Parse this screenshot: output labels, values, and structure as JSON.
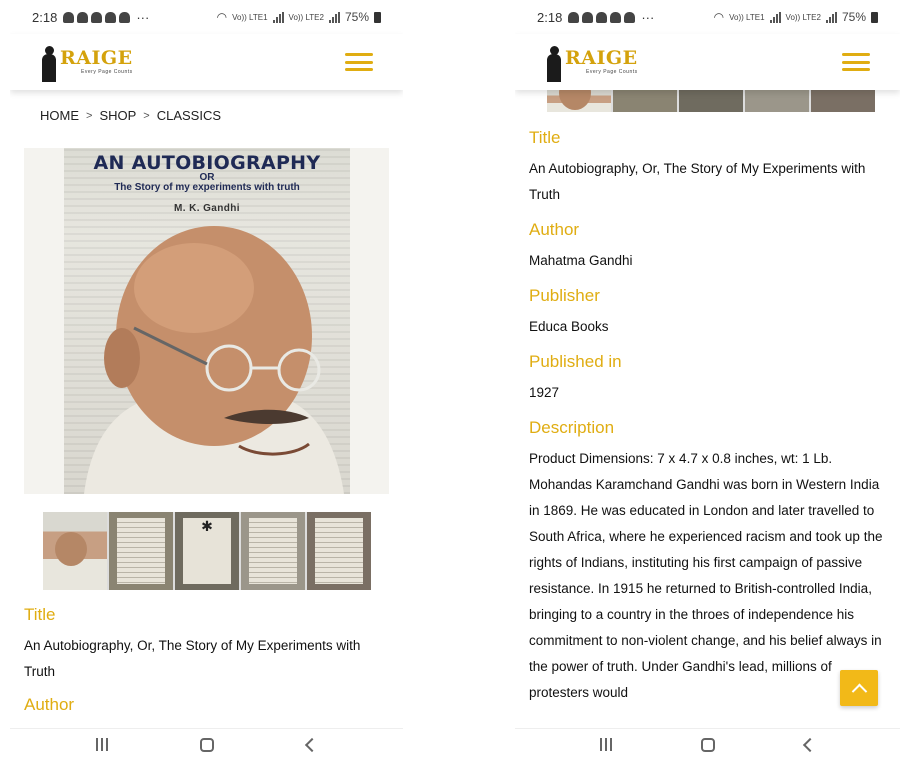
{
  "status_bar": {
    "time": "2:18",
    "more": "···",
    "network": "Vo)) LTE1",
    "network2": "Vo)) LTE2",
    "battery": "75%"
  },
  "brand": {
    "logo_text": "RAIGE",
    "tagline": "Every Page Counts"
  },
  "breadcrumb": {
    "home": "HOME",
    "shop": "SHOP",
    "category": "CLASSICS",
    "separator": ">"
  },
  "cover": {
    "title": "AN AUTOBIOGRAPHY",
    "or": "OR",
    "subtitle": "The Story of my experiments with truth",
    "author": "M. K. Gandhi"
  },
  "details": {
    "title_label": "Title",
    "title_value": "An Autobiography, Or, The Story of My Experiments with Truth",
    "author_label": "Author",
    "author_value": "Mahatma Gandhi",
    "publisher_label": "Publisher",
    "publisher_value": "Educa Books",
    "published_label": "Published in",
    "published_value": "1927",
    "description_label": "Description",
    "description_value": "Product Dimensions: 7 x 4.7 x 0.8 inches, wt: 1 Lb. Mohandas Karamchand Gandhi was born in Western India in 1869. He was educated in London and later travelled to South Africa, where he experienced racism and took up the rights of Indians, instituting his first campaign of passive resistance. In 1915 he returned to British-controlled India, bringing to a country in the throes of independence his commitment to non-violent change, and his belief always in the power of truth. Under Gandhi's lead, millions of protesters would"
  },
  "colors": {
    "accent": "#e0ad12",
    "scroll_button": "#f2b918"
  },
  "icons": {
    "menu": "hamburger-icon",
    "scroll_top": "chevron-up-icon",
    "nav_recent": "recent-apps-icon",
    "nav_home": "home-icon",
    "nav_back": "back-icon"
  }
}
